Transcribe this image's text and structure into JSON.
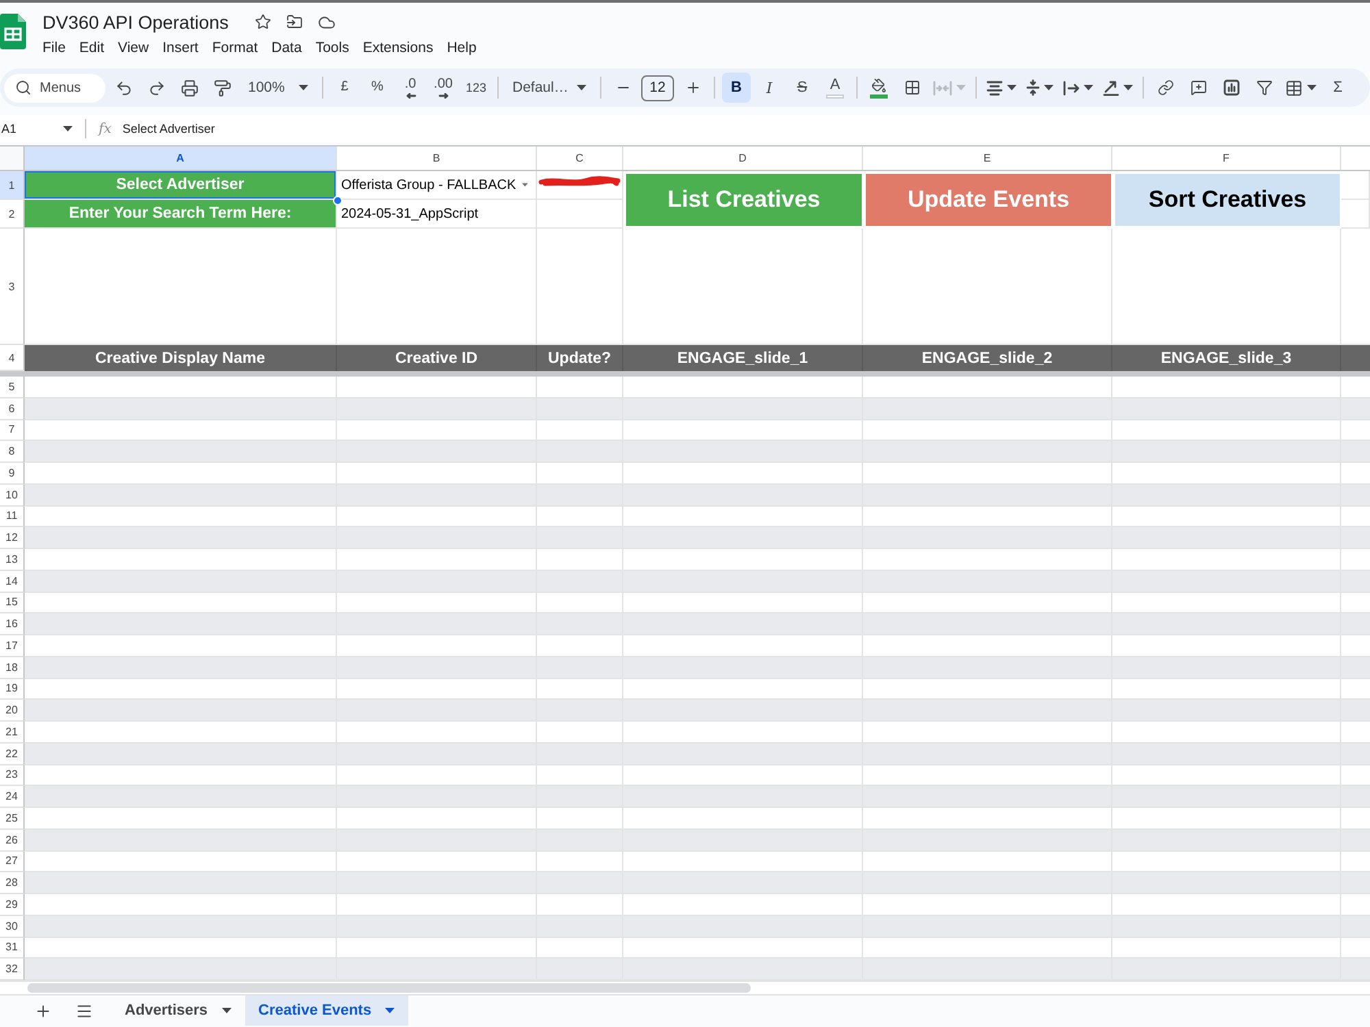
{
  "document": {
    "title": "DV360 API Operations"
  },
  "menu": [
    "File",
    "Edit",
    "View",
    "Insert",
    "Format",
    "Data",
    "Tools",
    "Extensions",
    "Help"
  ],
  "toolbar": {
    "search": {
      "placeholder": "Menus"
    },
    "zoom": "100%",
    "number_formats": [
      {
        "kind": "currency",
        "label": "£"
      },
      {
        "kind": "percent",
        "label": "%"
      },
      {
        "kind": "decrease_decimals",
        "label": ".0"
      },
      {
        "kind": "increase_decimals",
        "label": ".00"
      },
      {
        "kind": "more_formats",
        "label": "123"
      }
    ],
    "font": "Defaul…",
    "font_size": "12",
    "text_styles": [
      {
        "kind": "bold",
        "label": "B",
        "selected": true
      },
      {
        "kind": "italic",
        "label": "I",
        "selected": false
      },
      {
        "kind": "strikethrough",
        "label": "S",
        "selected": false
      },
      {
        "kind": "text_color",
        "label": "A",
        "selected": false
      }
    ],
    "merge": {
      "disabled": true
    },
    "functions": "Σ"
  },
  "formula_bar": {
    "cell": "A1",
    "fx": "fx",
    "value": "Select Advertiser"
  },
  "columns": [
    {
      "label": "A",
      "selected": true
    },
    {
      "label": "B",
      "selected": false
    },
    {
      "label": "C",
      "selected": false
    },
    {
      "label": "D",
      "selected": false
    },
    {
      "label": "E",
      "selected": false
    },
    {
      "label": "F",
      "selected": false
    }
  ],
  "buttons": [
    {
      "label": "List Creatives",
      "color": "#4caf50"
    },
    {
      "label": "Update Events",
      "color": "#e07b6a"
    },
    {
      "label": "Sort Creatives",
      "color": "#cfe2f3"
    }
  ],
  "rows": [
    {
      "number": "1",
      "kind": "input",
      "selected": true,
      "cells": [
        {
          "kind": "label",
          "text": "Select Advertiser",
          "selected": true
        },
        {
          "kind": "dropdown",
          "text": "Offerista Group - FALLBACK",
          "selected": false
        },
        {
          "kind": "redacted",
          "selected": false
        }
      ]
    },
    {
      "number": "2",
      "kind": "input",
      "selected": false,
      "cells": [
        {
          "kind": "label",
          "text": "Enter Your Search Term Here:",
          "selected": false
        },
        {
          "kind": "text",
          "text": "2024-05-31_AppScript",
          "selected": false
        }
      ]
    },
    {
      "number": "3",
      "kind": "spacer",
      "selected": false
    },
    {
      "number": "4",
      "kind": "header",
      "selected": false,
      "cells": [
        "Creative Display Name",
        "Creative ID",
        "Update?",
        "ENGAGE_slide_1",
        "ENGAGE_slide_2",
        "ENGAGE_slide_3"
      ]
    },
    {
      "number": "5",
      "kind": "data",
      "selected": false
    },
    {
      "number": "6",
      "kind": "data",
      "selected": false
    },
    {
      "number": "7",
      "kind": "data",
      "selected": false
    },
    {
      "number": "8",
      "kind": "data",
      "selected": false
    },
    {
      "number": "9",
      "kind": "data",
      "selected": false
    },
    {
      "number": "10",
      "kind": "data",
      "selected": false
    },
    {
      "number": "11",
      "kind": "data",
      "selected": false
    },
    {
      "number": "12",
      "kind": "data",
      "selected": false
    },
    {
      "number": "13",
      "kind": "data",
      "selected": false
    },
    {
      "number": "14",
      "kind": "data",
      "selected": false
    },
    {
      "number": "15",
      "kind": "data",
      "selected": false
    },
    {
      "number": "16",
      "kind": "data",
      "selected": false
    },
    {
      "number": "17",
      "kind": "data",
      "selected": false
    },
    {
      "number": "18",
      "kind": "data",
      "selected": false
    },
    {
      "number": "19",
      "kind": "data",
      "selected": false
    },
    {
      "number": "20",
      "kind": "data",
      "selected": false
    },
    {
      "number": "21",
      "kind": "data",
      "selected": false
    },
    {
      "number": "22",
      "kind": "data",
      "selected": false
    },
    {
      "number": "23",
      "kind": "data",
      "selected": false
    },
    {
      "number": "24",
      "kind": "data",
      "selected": false
    },
    {
      "number": "25",
      "kind": "data",
      "selected": false
    },
    {
      "number": "26",
      "kind": "data",
      "selected": false
    },
    {
      "number": "27",
      "kind": "data",
      "selected": false
    },
    {
      "number": "28",
      "kind": "data",
      "selected": false
    },
    {
      "number": "29",
      "kind": "data",
      "selected": false
    },
    {
      "number": "30",
      "kind": "data",
      "selected": false
    },
    {
      "number": "31",
      "kind": "data",
      "selected": false
    },
    {
      "number": "32",
      "kind": "data",
      "selected": false
    }
  ],
  "sheet_tabs": [
    {
      "label": "Advertisers",
      "selected": false
    },
    {
      "label": "Creative Events",
      "selected": true
    }
  ]
}
